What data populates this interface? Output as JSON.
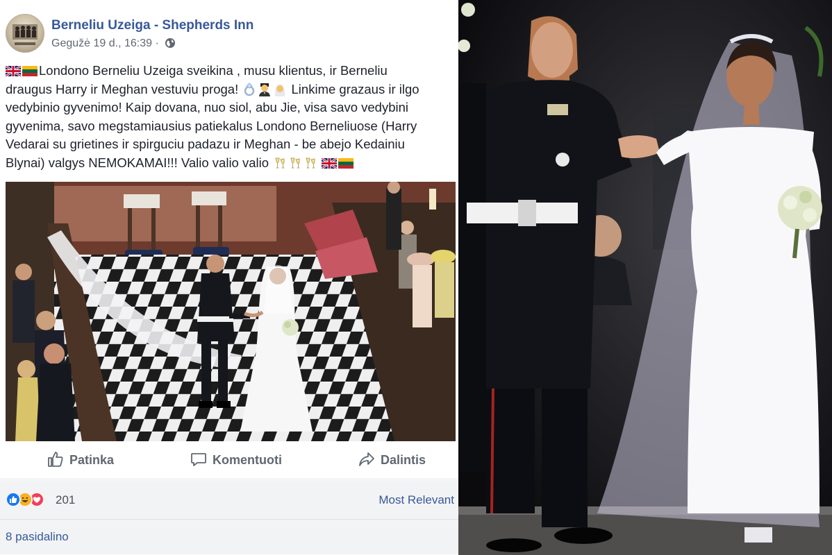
{
  "post": {
    "page_name": "Berneliu Uzeiga - Shepherds Inn",
    "date": "Gegužė 19 d., 16:39 ·",
    "privacy_icon": "globe-icon",
    "text_lines": [
      "Londono Berneliu Uzeiga sveikina , musu klientus, ir Berneliu",
      "draugus Harry ir Meghan vestuviu proga!",
      "Linkime grazaus ir ilgo",
      "vedybinio gyvenimo! Kaip dovana, nuo siol, abu Jie, visa savo vedybini",
      "gyvenima, savo megstamiausius patiekalus Londono Berneliuose (Harry",
      "Vedarai su grietines ir spirguciu padazu ir Meghan - be abejo Kedainiu",
      "Blynai) valgys NEMOKAMAI!!! Valio valio valio"
    ],
    "emojis": [
      "uk-flag",
      "lithuania-flag",
      "ring",
      "groom",
      "bride",
      "champagne-glasses"
    ],
    "actions": {
      "like": "Patinka",
      "comment": "Komentuoti",
      "share": "Dalintis"
    },
    "reaction_icons": [
      "like-reaction-icon",
      "haha-reaction-icon",
      "love-reaction-icon"
    ],
    "reaction_count": "201",
    "sort_label": "Most Relevant",
    "shares": "8 pasidalino"
  },
  "colors": {
    "link_blue": "#385898",
    "meta_gray": "#616770",
    "action_gray": "#606770",
    "footer_bg": "#f2f3f5",
    "like_blue": "#1877f2",
    "love_red": "#f33e58",
    "haha_yellow": "#f7b125"
  }
}
